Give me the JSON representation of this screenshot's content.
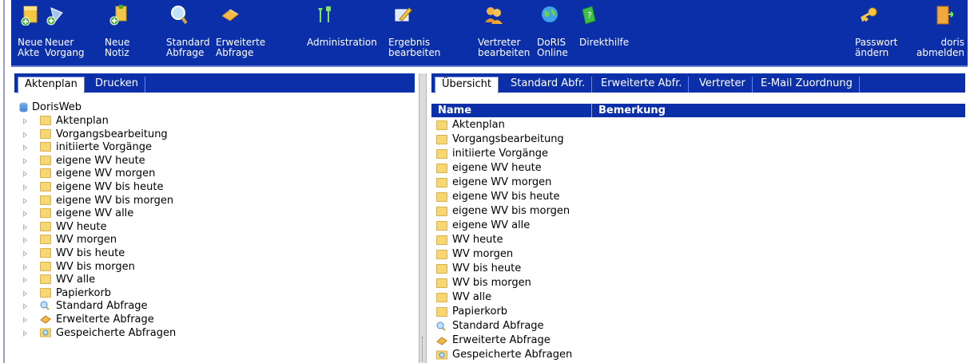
{
  "toolbar": {
    "buttons": [
      {
        "line1": "Neue",
        "line2": "Akte",
        "icon": "new-file-icon"
      },
      {
        "line1": "Neuer",
        "line2": "Vorgang",
        "icon": "new-process-icon"
      },
      {
        "line1": "Neue",
        "line2": "Notiz",
        "icon": "new-note-icon"
      },
      {
        "line1": "Standard",
        "line2": "Abfrage",
        "icon": "search-icon"
      },
      {
        "line1": "Erweiterte",
        "line2": "Abfrage",
        "icon": "advanced-search-icon"
      },
      {
        "line1": "Administration",
        "line2": "",
        "icon": "admin-tools-icon"
      },
      {
        "line1": "Ergebnis",
        "line2": "bearbeiten",
        "icon": "edit-result-icon"
      },
      {
        "line1": "Vertreter",
        "line2": "bearbeiten",
        "icon": "users-icon"
      },
      {
        "line1": "DoRIS",
        "line2": "Online",
        "icon": "globe-icon"
      },
      {
        "line1": "Direkthilfe",
        "line2": "",
        "icon": "help-icon"
      },
      {
        "line1": "Passwort",
        "line2": "ändern",
        "icon": "key-icon"
      },
      {
        "line1": "doris",
        "line2": "abmelden",
        "icon": "logout-door-icon"
      }
    ]
  },
  "left_panel": {
    "tabs": [
      "Aktenplan",
      "Drucken"
    ],
    "active_tab": "Aktenplan",
    "root": "DorisWeb",
    "items": [
      "Aktenplan",
      "Vorgangsbearbeitung",
      "initiierte Vorgänge",
      "eigene WV heute",
      "eigene WV morgen",
      "eigene WV bis heute",
      "eigene WV bis morgen",
      "eigene WV alle",
      "WV heute",
      "WV morgen",
      "WV bis heute",
      "WV bis morgen",
      "WV alle",
      "Papierkorb",
      "Standard Abfrage",
      "Erweiterte Abfrage",
      "Gespeicherte Abfragen"
    ]
  },
  "right_panel": {
    "tabs": [
      "Übersicht",
      "Standard Abfr.",
      "Erweiterte Abfr.",
      "Vertreter",
      "E-Mail Zuordnung"
    ],
    "active_tab": "Übersicht",
    "columns": {
      "name": "Name",
      "remark": "Bemerkung"
    },
    "items": [
      "Aktenplan",
      "Vorgangsbearbeitung",
      "initiierte Vorgänge",
      "eigene WV heute",
      "eigene WV morgen",
      "eigene WV bis heute",
      "eigene WV bis morgen",
      "eigene WV alle",
      "WV heute",
      "WV morgen",
      "WV bis heute",
      "WV bis morgen",
      "WV alle",
      "Papierkorb",
      "Standard Abfrage",
      "Erweiterte Abfrage",
      "Gespeicherte Abfragen"
    ]
  },
  "colors": {
    "toolbar_bg": "#0b2fa8",
    "folder": "#f7d774",
    "tab_text": "#ffffff"
  }
}
